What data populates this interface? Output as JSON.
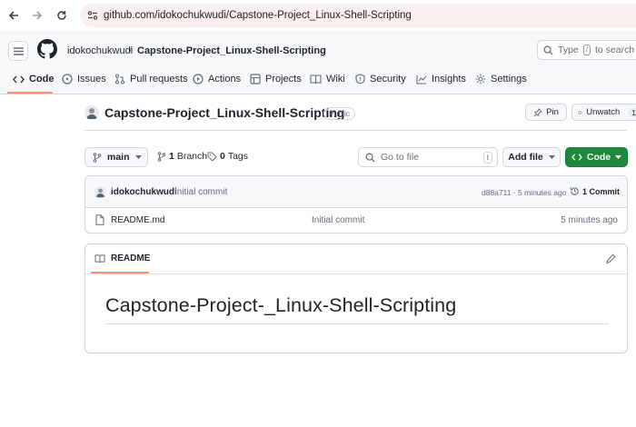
{
  "browser": {
    "url": "github.com/idokochukwudi/Capstone-Project_Linux-Shell-Scripting"
  },
  "header": {
    "owner": "idokochukwudi",
    "separator": "/",
    "repo": "Capstone-Project_Linux-Shell-Scripting",
    "search_placeholder_pre": "Type",
    "search_key": "/",
    "search_placeholder_post": "to search"
  },
  "tabs": [
    {
      "label": "Code",
      "icon": "code-icon",
      "selected": true
    },
    {
      "label": "Issues",
      "icon": "issue-icon"
    },
    {
      "label": "Pull requests",
      "icon": "pull-request-icon"
    },
    {
      "label": "Actions",
      "icon": "play-icon"
    },
    {
      "label": "Projects",
      "icon": "table-icon"
    },
    {
      "label": "Wiki",
      "icon": "book-icon"
    },
    {
      "label": "Security",
      "icon": "shield-icon"
    },
    {
      "label": "Insights",
      "icon": "graph-icon"
    },
    {
      "label": "Settings",
      "icon": "gear-icon"
    }
  ],
  "repo": {
    "title": "Capstone-Project_Linux-Shell-Scripting",
    "visibility": "Public",
    "pin_label": "Pin",
    "unwatch_label": "Unwatch",
    "watch_count": "1"
  },
  "toolbar": {
    "branch": "main",
    "branch_count": "1",
    "branch_label": "Branch",
    "tag_count": "0",
    "tag_label": "Tags",
    "goto_placeholder": "Go to file",
    "goto_key": "t",
    "add_file_label": "Add file",
    "code_label": "Code"
  },
  "latest_commit": {
    "author": "idokochukwudi",
    "message": "Initial commit",
    "meta": "d88a711 · 5 minutes ago",
    "count_label": "1 Commit"
  },
  "files": [
    {
      "name": "README.md",
      "commit": "Initial commit",
      "age": "5 minutes ago"
    }
  ],
  "readme": {
    "tab_label": "README",
    "heading": "Capstone-Project-_Linux-Shell-Scripting"
  },
  "colors": {
    "accent_underline": "#fd8c73",
    "code_button": "#1f883d",
    "url_bar": "#fbeeee"
  }
}
